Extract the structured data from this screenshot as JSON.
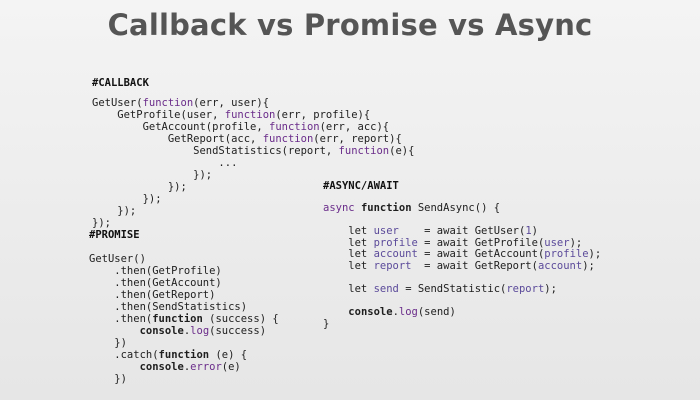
{
  "title": "Callback vs Promise vs Async",
  "sections": {
    "callback": {
      "label": "#CALLBACK",
      "lines": [
        [
          [
            "GetUser(",
            ""
          ],
          [
            "function",
            "kw"
          ],
          [
            "(err, user){",
            ""
          ]
        ],
        [
          [
            "    GetProfile(user, ",
            ""
          ],
          [
            "function",
            "kw"
          ],
          [
            "(err, profile){",
            ""
          ]
        ],
        [
          [
            "        GetAccount(profile, ",
            ""
          ],
          [
            "function",
            "kw"
          ],
          [
            "(err, acc){",
            ""
          ]
        ],
        [
          [
            "            GetReport(acc, ",
            ""
          ],
          [
            "function",
            "kw"
          ],
          [
            "(err, report){",
            ""
          ]
        ],
        [
          [
            "                SendStatistics(report, ",
            ""
          ],
          [
            "function",
            "kw"
          ],
          [
            "(e){",
            ""
          ]
        ],
        [
          [
            "                    ...",
            ""
          ]
        ],
        [
          [
            "                });",
            ""
          ]
        ],
        [
          [
            "            });",
            ""
          ]
        ],
        [
          [
            "        });",
            ""
          ]
        ],
        [
          [
            "    });",
            ""
          ]
        ],
        [
          [
            "});",
            ""
          ]
        ]
      ]
    },
    "promise": {
      "label": "#PROMISE",
      "lines": [
        [
          [
            "GetUser()",
            ""
          ]
        ],
        [
          [
            "    .then(GetProfile)",
            ""
          ]
        ],
        [
          [
            "    .then(GetAccount)",
            ""
          ]
        ],
        [
          [
            "    .then(GetReport)",
            ""
          ]
        ],
        [
          [
            "    .then(SendStatistics)",
            ""
          ]
        ],
        [
          [
            "    .then(",
            ""
          ],
          [
            "function",
            "kwb"
          ],
          [
            " (success) {",
            ""
          ]
        ],
        [
          [
            "        ",
            ""
          ],
          [
            "console",
            "kwb"
          ],
          [
            ".",
            ""
          ],
          [
            "log",
            "kw"
          ],
          [
            "(success)",
            ""
          ]
        ],
        [
          [
            "    })",
            ""
          ]
        ],
        [
          [
            "    .catch(",
            ""
          ],
          [
            "function",
            "kwb"
          ],
          [
            " (e) {",
            ""
          ]
        ],
        [
          [
            "        ",
            ""
          ],
          [
            "console",
            "kwb"
          ],
          [
            ".",
            ""
          ],
          [
            "error",
            "kw"
          ],
          [
            "(e)",
            ""
          ]
        ],
        [
          [
            "    })",
            ""
          ]
        ]
      ]
    },
    "async": {
      "label": "#ASYNC/AWAIT",
      "lines": [
        [
          [
            "async ",
            "kw"
          ],
          [
            "function ",
            "kwb"
          ],
          [
            "SendAsync",
            "fn"
          ],
          [
            "() {",
            ""
          ]
        ],
        [
          [
            "",
            ""
          ]
        ],
        [
          [
            "    let ",
            ""
          ],
          [
            "user",
            "var"
          ],
          [
            "    = await GetUser(",
            ""
          ],
          [
            "1",
            "var"
          ],
          [
            ")",
            ""
          ]
        ],
        [
          [
            "    let ",
            ""
          ],
          [
            "profile",
            "var"
          ],
          [
            " = await GetProfile(",
            ""
          ],
          [
            "user",
            "var"
          ],
          [
            ");",
            ""
          ]
        ],
        [
          [
            "    let ",
            ""
          ],
          [
            "account",
            "var"
          ],
          [
            " = await GetAccount(",
            ""
          ],
          [
            "profile",
            "var"
          ],
          [
            ");",
            ""
          ]
        ],
        [
          [
            "    let ",
            ""
          ],
          [
            "report",
            "var"
          ],
          [
            "  = await GetReport(",
            ""
          ],
          [
            "account",
            "var"
          ],
          [
            ");",
            ""
          ]
        ],
        [
          [
            "",
            ""
          ]
        ],
        [
          [
            "    let ",
            ""
          ],
          [
            "send",
            "var"
          ],
          [
            " = SendStatistic(",
            ""
          ],
          [
            "report",
            "var"
          ],
          [
            ");",
            ""
          ]
        ],
        [
          [
            "",
            ""
          ]
        ],
        [
          [
            "    ",
            ""
          ],
          [
            "console",
            "kwb"
          ],
          [
            ".",
            ""
          ],
          [
            "log",
            "kw"
          ],
          [
            "(send)",
            ""
          ]
        ],
        [
          [
            "}",
            ""
          ]
        ]
      ]
    }
  }
}
